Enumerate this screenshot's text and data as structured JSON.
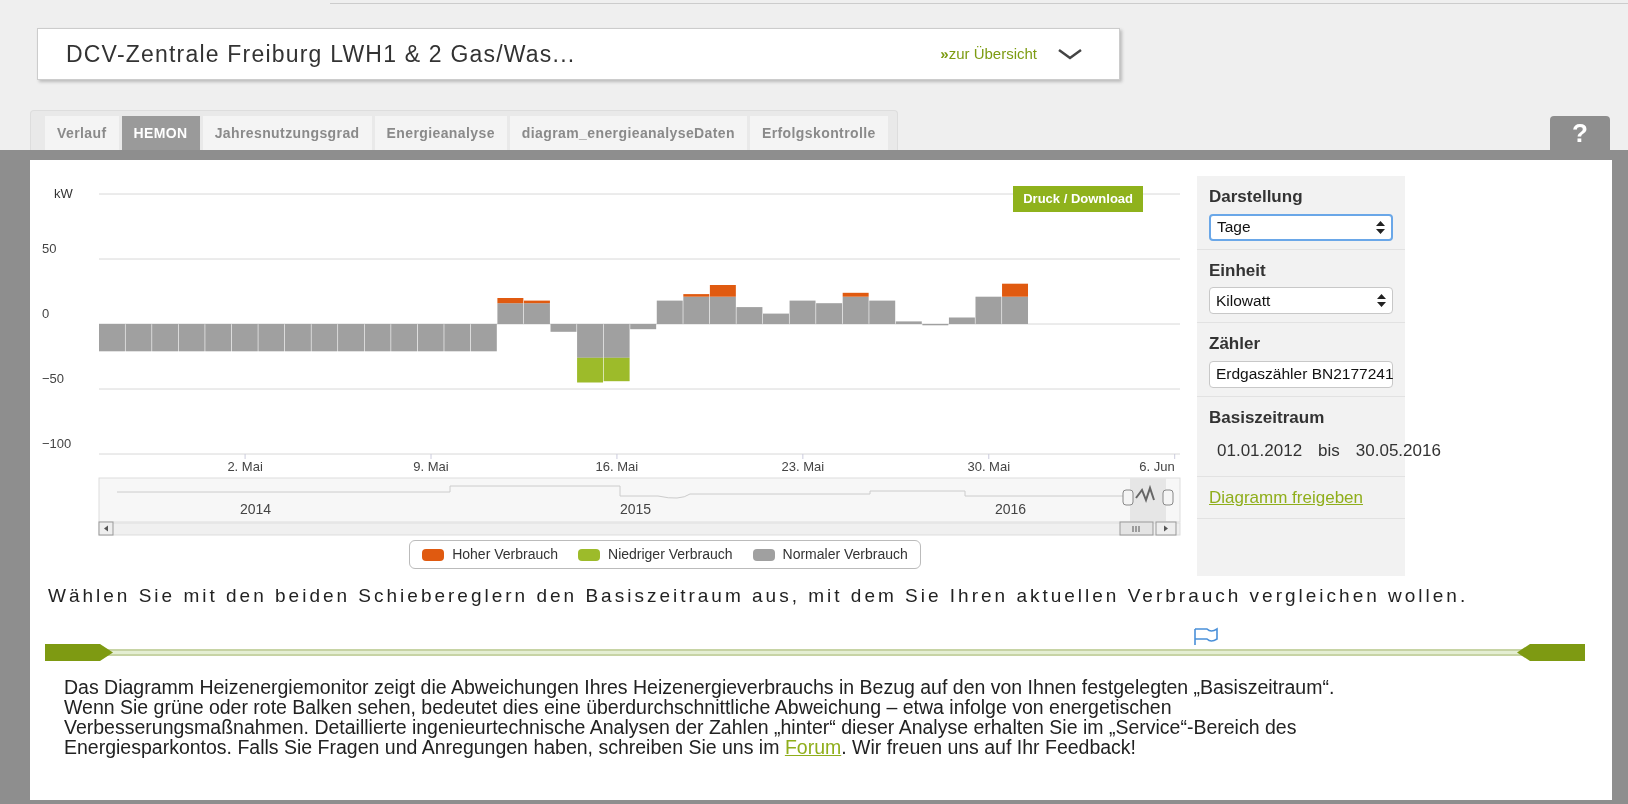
{
  "header": {
    "title": "DCV-Zentrale Freiburg LWH1 & 2 Gas/Was...",
    "link_prefix": "»",
    "link": "zur Übersicht"
  },
  "tabs": [
    {
      "label": "Verlauf",
      "selected": false
    },
    {
      "label": "HEMON",
      "selected": true
    },
    {
      "label": "Jahresnutzungsgrad",
      "selected": false
    },
    {
      "label": "Energieanalyse",
      "selected": false
    },
    {
      "label": "diagram_energieanalyseDaten",
      "selected": false
    },
    {
      "label": "Erfolgskontrolle",
      "selected": false
    }
  ],
  "help_tab": "?",
  "chart": {
    "print_button": "Druck / Download",
    "chart_data": {
      "type": "bar",
      "ylabel": "kW",
      "stacked": true,
      "grid": true,
      "x": [
        -3,
        -2,
        -1,
        0,
        1,
        2,
        3,
        4,
        5,
        6,
        7,
        8,
        9,
        10,
        11,
        12,
        13,
        14,
        15,
        16,
        17,
        18,
        19,
        20,
        21,
        22,
        23,
        24,
        25,
        26,
        27,
        28,
        29,
        30,
        31
      ],
      "series": [
        {
          "name": "Normaler Verbrauch",
          "color": "#a0a0a0",
          "values": [
            -21,
            -21,
            -21,
            -21,
            -21,
            -21,
            -21,
            -21,
            -21,
            -21,
            -21,
            -21,
            -21,
            -21,
            -21,
            16,
            16,
            -6,
            -26,
            -26,
            -4,
            18,
            21,
            21,
            13,
            8,
            18,
            16,
            21,
            18,
            2,
            -1,
            5,
            21,
            21
          ]
        },
        {
          "name": "Hoher Verbrauch",
          "color": "#e05a10",
          "values": [
            null,
            null,
            null,
            null,
            null,
            null,
            null,
            null,
            null,
            null,
            null,
            null,
            null,
            null,
            null,
            4,
            2,
            null,
            null,
            null,
            null,
            null,
            2,
            9,
            null,
            null,
            null,
            null,
            3,
            null,
            null,
            null,
            null,
            null,
            10
          ]
        },
        {
          "name": "Niedriger Verbrauch",
          "color": "#9dbb2a",
          "values": [
            null,
            null,
            null,
            null,
            null,
            null,
            null,
            null,
            null,
            null,
            null,
            null,
            null,
            null,
            null,
            null,
            null,
            null,
            -19,
            -18,
            null,
            null,
            null,
            null,
            null,
            null,
            null,
            null,
            null,
            null,
            null,
            null,
            null,
            null,
            null
          ]
        }
      ],
      "xlim": [
        -3.5,
        37.2
      ],
      "ylim": [
        -100,
        100
      ],
      "xticks": [
        {
          "value": 2,
          "label": "2. Mai"
        },
        {
          "value": 9,
          "label": "9. Mai"
        },
        {
          "value": 16,
          "label": "16. Mai"
        },
        {
          "value": 23,
          "label": "23. Mai"
        },
        {
          "value": 30,
          "label": "30. Mai"
        },
        {
          "value": 37,
          "label": "6. Jun"
        }
      ],
      "yticks": [
        -100,
        -50,
        0,
        50
      ]
    },
    "navigator_years": [
      "2014",
      "2015",
      "2016"
    ]
  },
  "sidebar": [
    {
      "kind": "select",
      "label": "Darstellung",
      "value": "Tage",
      "focused": true
    },
    {
      "kind": "select",
      "label": "Einheit",
      "value": "Kilowatt",
      "focused": false
    },
    {
      "kind": "select",
      "label": "Zähler",
      "value": "Erdgaszähler BN2177241",
      "focused": false
    },
    {
      "kind": "range",
      "label": "Basiszeitraum",
      "from": "01.01.2012",
      "separator": "bis",
      "to": "30.05.2016"
    },
    {
      "kind": "link",
      "label": "Diagramm freigeben"
    }
  ],
  "instruction": "Wählen Sie mit den beiden Schiebereglern den Basiszeitraum aus, mit dem Sie Ihren aktuellen Verbrauch vergleichen wollen.",
  "description": {
    "before": "Das Diagramm Heizenergiemonitor zeigt die Abweichungen Ihres Heizenergieverbrauchs in Bezug auf den von Ihnen festgelegten „Basiszeitraum“. Wenn Sie grüne oder rote Balken sehen, bedeutet dies eine überdurchschnittliche Abweichung – etwa infolge von energetischen Verbesserungsmaßnahmen. Detaillierte ingenieurtechnische Analysen der Zahlen „hinter“ dieser Analyse erhalten Sie im „Service“-Bereich des Energiesparkontos. Falls Sie Fragen und Anregungen haben, schreiben Sie uns im ",
    "link": "Forum",
    "after": ". Wir freuen uns auf Ihr Feedback!"
  }
}
